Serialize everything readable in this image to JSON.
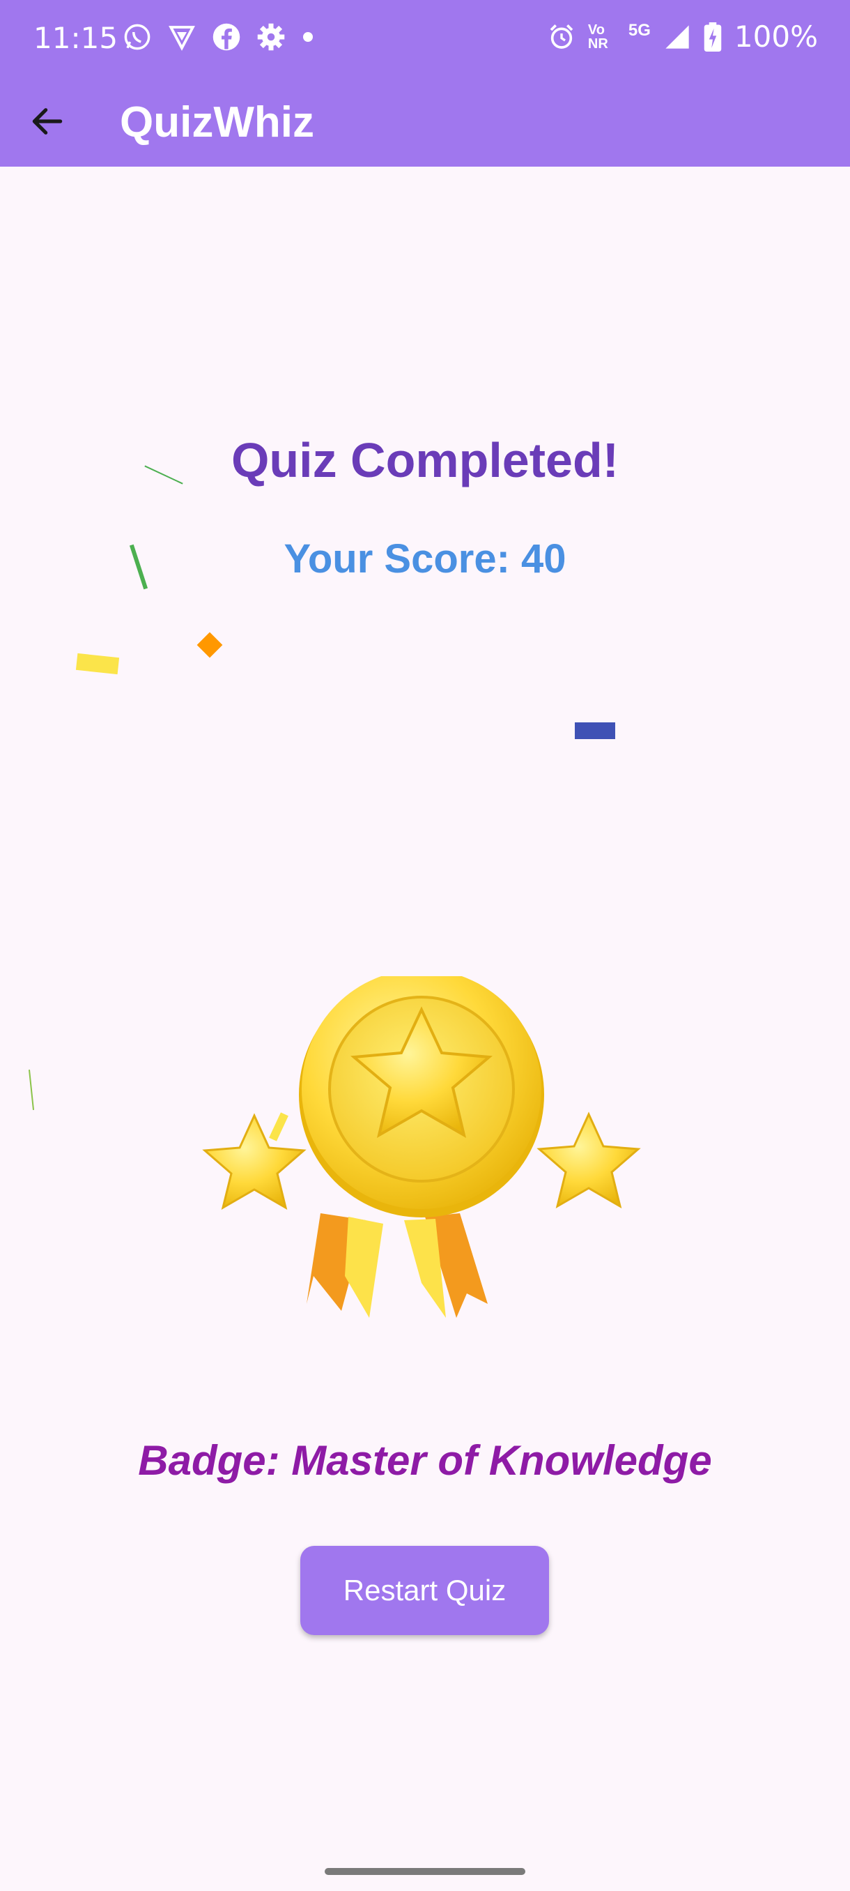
{
  "status_bar": {
    "time": "11:15",
    "battery": "100%",
    "network": "5G",
    "volte": "Vo NR",
    "icons": [
      "whatsapp-icon",
      "vpn-icon",
      "facebook-icon",
      "settings-icon",
      "dot-icon",
      "alarm-icon",
      "signal-icon",
      "battery-icon"
    ]
  },
  "app_bar": {
    "title": "QuizWhiz",
    "back_icon": "arrow-left-icon"
  },
  "result": {
    "title": "Quiz Completed!",
    "score_text": "Your Score: 40",
    "badge_text": "Badge: Master of Knowledge",
    "restart_label": "Restart Quiz"
  },
  "colors": {
    "primary": "#A077EE",
    "title": "#6A3CB8",
    "score": "#4A90E2",
    "badge": "#8E1BA6",
    "background": "#FDF6FC"
  }
}
